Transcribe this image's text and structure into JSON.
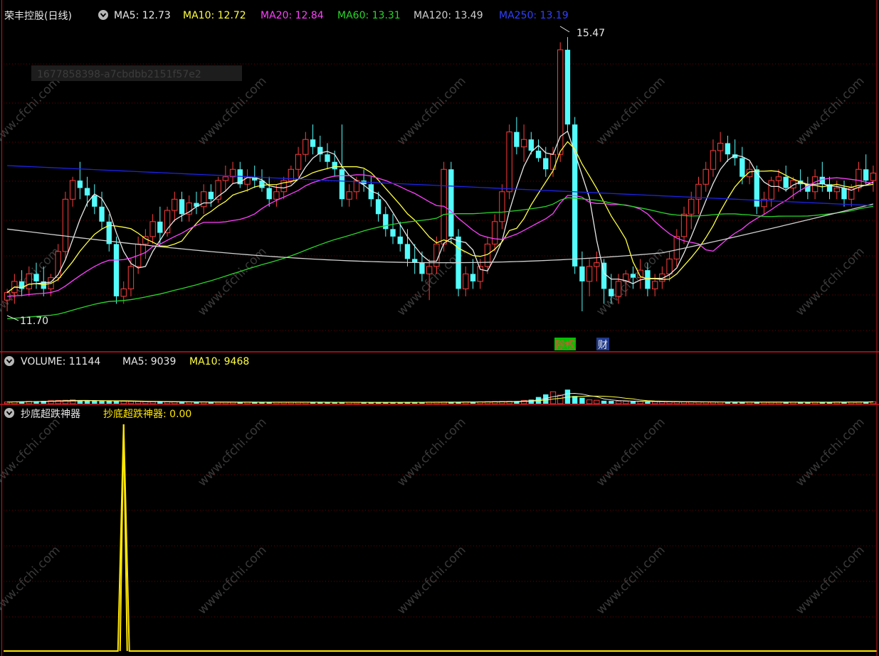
{
  "colors": {
    "background": "#000000",
    "up": "#ff3c3c",
    "down": "#54fcfc",
    "grid": "#6e0000",
    "separator": "#c8141e",
    "ma5": "#e8e8e8",
    "ma10": "#ffff40",
    "ma20": "#ff40ff",
    "ma60": "#28d628",
    "ma120": "#d0d0d0",
    "ma250": "#1c24e8",
    "indicator": "#ffe700",
    "watermark": "#3a3a3a"
  },
  "header": {
    "title": "荣丰控股(日线)",
    "ma5_label": "MA5: 12.73",
    "ma10_label": "MA10: 12.72",
    "ma20_label": "MA20: 12.84",
    "ma60_label": "MA60: 13.31",
    "ma120_label": "MA120: 13.49",
    "ma250_label": "MA250: 13.19",
    "chevron_icon": "chevron-down-icon"
  },
  "id_overlay": "1677858398-a7cbdbb2151f57e2",
  "annotations": {
    "high_label": "15.47",
    "low_label": "11.70",
    "tag_dividend": "除权",
    "tag_finance": "财"
  },
  "volume_header": {
    "volume_label": "VOLUME: 11144",
    "ma5_label": "MA5: 9039",
    "ma10_label": "MA10: 9468"
  },
  "indicator_header": {
    "name": "抄底超跌神器",
    "value_label": "抄底超跌神器: 0.00"
  },
  "watermark_text": "www.cfchi.com",
  "chart_data": [
    {
      "type": "candlestick",
      "series_name": "荣丰控股(日线)",
      "ylim": [
        11.4,
        15.7
      ],
      "x_count": 120,
      "high_marker": {
        "index": 77,
        "value": 15.47
      },
      "low_marker": {
        "index": 0,
        "value": 11.7
      },
      "ohlc_anchors": [
        [
          0,
          11.95,
          12.1,
          11.8,
          12.05
        ],
        [
          1,
          12.05,
          12.3,
          11.9,
          12.2
        ],
        [
          2,
          12.2,
          12.35,
          12.0,
          12.1
        ],
        [
          3,
          12.1,
          12.4,
          12.0,
          12.3
        ],
        [
          4,
          12.3,
          12.45,
          12.1,
          12.2
        ],
        [
          5,
          12.2,
          12.4,
          12.0,
          12.1
        ],
        [
          6,
          12.1,
          12.3,
          12.0,
          12.25
        ],
        [
          7,
          12.25,
          12.7,
          12.2,
          12.6
        ],
        [
          8,
          12.6,
          13.4,
          12.5,
          13.3
        ],
        [
          9,
          13.3,
          13.6,
          13.2,
          13.55
        ],
        [
          10,
          13.55,
          13.8,
          13.3,
          13.45
        ],
        [
          11,
          13.45,
          13.6,
          13.2,
          13.35
        ],
        [
          12,
          13.35,
          13.5,
          13.1,
          13.2
        ],
        [
          13,
          13.2,
          13.4,
          12.9,
          13.0
        ],
        [
          14,
          13.0,
          13.1,
          12.6,
          12.7
        ],
        [
          15,
          12.7,
          12.8,
          11.9,
          12.0
        ],
        [
          16,
          12.0,
          12.2,
          11.9,
          12.1
        ],
        [
          17,
          12.1,
          12.5,
          12.0,
          12.4
        ],
        [
          18,
          12.4,
          12.8,
          12.3,
          12.7
        ],
        [
          19,
          12.7,
          12.9,
          12.5,
          12.8
        ],
        [
          20,
          12.8,
          13.1,
          12.7,
          13.0
        ],
        [
          21,
          13.0,
          13.2,
          12.7,
          12.85
        ],
        [
          22,
          12.85,
          13.2,
          12.8,
          13.15
        ],
        [
          23,
          13.15,
          13.4,
          13.0,
          13.3
        ],
        [
          24,
          13.3,
          13.4,
          13.0,
          13.1
        ],
        [
          25,
          13.1,
          13.35,
          13.0,
          13.25
        ],
        [
          26,
          13.25,
          13.4,
          13.1,
          13.2
        ],
        [
          27,
          13.2,
          13.5,
          13.1,
          13.4
        ],
        [
          28,
          13.4,
          13.5,
          13.2,
          13.3
        ],
        [
          29,
          13.3,
          13.6,
          13.25,
          13.55
        ],
        [
          30,
          13.55,
          13.75,
          13.4,
          13.6
        ],
        [
          31,
          13.6,
          13.8,
          13.5,
          13.7
        ],
        [
          32,
          13.7,
          13.8,
          13.45,
          13.5
        ],
        [
          33,
          13.5,
          13.7,
          13.4,
          13.6
        ],
        [
          34,
          13.6,
          13.75,
          13.45,
          13.55
        ],
        [
          35,
          13.55,
          13.7,
          13.4,
          13.45
        ],
        [
          36,
          13.45,
          13.6,
          13.2,
          13.3
        ],
        [
          37,
          13.3,
          13.5,
          13.2,
          13.4
        ],
        [
          38,
          13.4,
          13.6,
          13.3,
          13.55
        ],
        [
          39,
          13.55,
          13.75,
          13.5,
          13.7
        ],
        [
          40,
          13.7,
          14.0,
          13.6,
          13.9
        ],
        [
          41,
          13.9,
          14.2,
          13.8,
          14.1
        ],
        [
          42,
          14.1,
          14.3,
          13.9,
          14.0
        ],
        [
          43,
          14.0,
          14.15,
          13.8,
          13.9
        ],
        [
          44,
          13.9,
          14.05,
          13.7,
          13.8
        ],
        [
          45,
          13.8,
          13.95,
          13.6,
          13.7
        ],
        [
          46,
          13.7,
          14.3,
          13.2,
          13.3
        ],
        [
          47,
          13.3,
          13.5,
          13.2,
          13.4
        ],
        [
          48,
          13.4,
          13.6,
          13.3,
          13.55
        ],
        [
          49,
          13.55,
          13.7,
          13.4,
          13.5
        ],
        [
          50,
          13.5,
          13.6,
          13.2,
          13.3
        ],
        [
          51,
          13.3,
          13.4,
          13.0,
          13.1
        ],
        [
          52,
          13.1,
          13.2,
          12.8,
          12.9
        ],
        [
          53,
          12.9,
          13.1,
          12.7,
          12.8
        ],
        [
          54,
          12.8,
          13.0,
          12.6,
          12.7
        ],
        [
          55,
          12.7,
          12.9,
          12.4,
          12.5
        ],
        [
          56,
          12.5,
          12.7,
          12.3,
          12.45
        ],
        [
          57,
          12.45,
          12.6,
          12.2,
          12.3
        ],
        [
          58,
          12.3,
          12.5,
          11.95,
          12.4
        ],
        [
          59,
          12.4,
          12.8,
          12.3,
          12.7
        ],
        [
          60,
          12.7,
          13.8,
          12.6,
          13.7
        ],
        [
          61,
          13.7,
          13.8,
          12.7,
          12.8
        ],
        [
          62,
          12.8,
          12.9,
          12.0,
          12.1
        ],
        [
          63,
          12.1,
          12.4,
          12.0,
          12.3
        ],
        [
          64,
          12.3,
          12.5,
          12.1,
          12.2
        ],
        [
          65,
          12.2,
          12.5,
          12.1,
          12.4
        ],
        [
          66,
          12.4,
          12.8,
          12.3,
          12.7
        ],
        [
          67,
          12.7,
          13.1,
          12.6,
          13.0
        ],
        [
          68,
          13.0,
          13.5,
          12.9,
          13.4
        ],
        [
          69,
          13.4,
          14.3,
          13.3,
          14.2
        ],
        [
          70,
          14.2,
          14.4,
          13.9,
          14.0
        ],
        [
          71,
          14.0,
          14.3,
          13.8,
          14.1
        ],
        [
          72,
          14.1,
          14.2,
          13.9,
          13.95
        ],
        [
          73,
          13.95,
          14.1,
          13.8,
          13.85
        ],
        [
          74,
          13.85,
          14.0,
          13.6,
          13.7
        ],
        [
          75,
          13.7,
          14.0,
          13.6,
          13.9
        ],
        [
          76,
          13.9,
          15.4,
          13.8,
          15.3
        ],
        [
          77,
          15.3,
          15.47,
          14.2,
          14.3
        ],
        [
          78,
          14.3,
          14.4,
          12.3,
          12.4
        ],
        [
          79,
          12.4,
          12.6,
          11.8,
          12.2
        ],
        [
          80,
          12.2,
          12.5,
          12.0,
          12.4
        ],
        [
          81,
          12.4,
          12.6,
          12.2,
          12.45
        ],
        [
          82,
          12.45,
          12.5,
          11.9,
          12.1
        ],
        [
          83,
          12.1,
          12.3,
          11.9,
          12.0
        ],
        [
          84,
          12.0,
          12.3,
          11.9,
          12.2
        ],
        [
          85,
          12.2,
          12.35,
          12.0,
          12.3
        ],
        [
          86,
          12.3,
          12.4,
          12.1,
          12.25
        ],
        [
          87,
          12.25,
          12.5,
          12.1,
          12.35
        ],
        [
          88,
          12.35,
          12.45,
          12.0,
          12.1
        ],
        [
          89,
          12.1,
          12.3,
          12.0,
          12.2
        ],
        [
          90,
          12.2,
          12.4,
          12.1,
          12.3
        ],
        [
          91,
          12.3,
          12.6,
          12.2,
          12.5
        ],
        [
          92,
          12.5,
          12.9,
          12.4,
          12.8
        ],
        [
          93,
          12.8,
          13.2,
          12.7,
          13.1
        ],
        [
          94,
          13.1,
          13.4,
          12.9,
          13.3
        ],
        [
          95,
          13.3,
          13.6,
          13.1,
          13.5
        ],
        [
          96,
          13.5,
          13.8,
          13.4,
          13.7
        ],
        [
          97,
          13.7,
          14.1,
          13.6,
          13.95
        ],
        [
          98,
          13.95,
          14.2,
          13.8,
          14.05
        ],
        [
          99,
          14.05,
          14.15,
          13.8,
          13.9
        ],
        [
          100,
          13.9,
          14.1,
          13.75,
          13.85
        ],
        [
          101,
          13.85,
          14.0,
          13.5,
          13.6
        ],
        [
          102,
          13.6,
          13.8,
          13.5,
          13.7
        ],
        [
          103,
          13.7,
          13.75,
          13.1,
          13.2
        ],
        [
          104,
          13.2,
          13.4,
          13.1,
          13.3
        ],
        [
          105,
          13.3,
          13.6,
          13.2,
          13.55
        ],
        [
          106,
          13.55,
          13.7,
          13.4,
          13.6
        ],
        [
          107,
          13.6,
          13.75,
          13.4,
          13.45
        ],
        [
          108,
          13.45,
          13.6,
          13.3,
          13.55
        ],
        [
          109,
          13.55,
          13.7,
          13.4,
          13.5
        ],
        [
          110,
          13.5,
          13.6,
          13.3,
          13.4
        ],
        [
          111,
          13.4,
          13.7,
          13.3,
          13.6
        ],
        [
          112,
          13.6,
          13.8,
          13.4,
          13.5
        ],
        [
          113,
          13.5,
          13.6,
          13.3,
          13.4
        ],
        [
          114,
          13.4,
          13.55,
          13.3,
          13.45
        ],
        [
          115,
          13.45,
          13.55,
          13.2,
          13.3
        ],
        [
          116,
          13.3,
          13.5,
          13.2,
          13.45
        ],
        [
          117,
          13.45,
          13.8,
          13.4,
          13.7
        ],
        [
          118,
          13.7,
          13.9,
          13.5,
          13.55
        ],
        [
          119,
          13.55,
          13.75,
          13.4,
          13.65
        ]
      ],
      "moving_averages": [
        {
          "name": "MA5",
          "value": 12.73
        },
        {
          "name": "MA10",
          "value": 12.72
        },
        {
          "name": "MA20",
          "value": 12.84
        },
        {
          "name": "MA60",
          "value": 13.31
        },
        {
          "name": "MA120",
          "value": 13.49
        },
        {
          "name": "MA250",
          "value": 13.19
        }
      ]
    },
    {
      "type": "bar",
      "series_name": "VOLUME",
      "latest": 11144,
      "ma5": 9039,
      "ma10": 9468,
      "ylim": [
        0,
        80000
      ],
      "anchor_values": [
        [
          0,
          4000
        ],
        [
          8,
          8000
        ],
        [
          9,
          9000
        ],
        [
          10,
          7000
        ],
        [
          20,
          4500
        ],
        [
          30,
          3500
        ],
        [
          40,
          3500
        ],
        [
          50,
          3000
        ],
        [
          60,
          3800
        ],
        [
          65,
          4500
        ],
        [
          70,
          6000
        ],
        [
          72,
          9500
        ],
        [
          75,
          28000
        ],
        [
          76,
          20000
        ],
        [
          77,
          33000
        ],
        [
          78,
          18000
        ],
        [
          79,
          14000
        ],
        [
          80,
          9000
        ],
        [
          82,
          7000
        ],
        [
          85,
          5500
        ],
        [
          90,
          4500
        ],
        [
          95,
          4000
        ],
        [
          100,
          3800
        ],
        [
          110,
          3500
        ],
        [
          119,
          4500
        ]
      ]
    },
    {
      "type": "line",
      "series_name": "抄底超跌神器",
      "ylim": [
        0,
        1
      ],
      "latest": 0.0,
      "spike": {
        "index": 16,
        "value": 1.0
      }
    }
  ]
}
